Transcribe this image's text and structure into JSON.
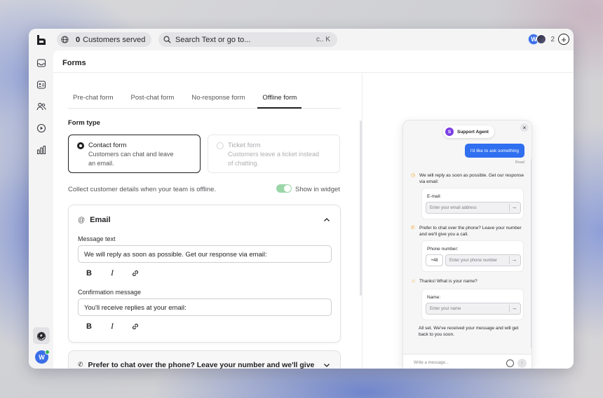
{
  "topbar": {
    "served_count": "0",
    "served_label": "Customers served",
    "search_placeholder": "Search Text or go to...",
    "search_shortcut": "c.. K",
    "avatar_initial": "W",
    "online_count": "2",
    "add_label": "+"
  },
  "sidebar": {
    "items": [
      {
        "icon": "inbox-icon"
      },
      {
        "icon": "contact-card-icon"
      },
      {
        "icon": "users-icon"
      },
      {
        "icon": "play-circle-icon"
      },
      {
        "icon": "bar-chart-icon"
      }
    ],
    "bottom": [
      {
        "icon": "gear-icon"
      },
      {
        "icon": "help-icon"
      }
    ],
    "avatar_initial": "W",
    "status_color": "#2fb35a"
  },
  "page": {
    "title": "Forms",
    "tabs": [
      {
        "label": "Pre-chat form"
      },
      {
        "label": "Post-chat form"
      },
      {
        "label": "No-response form"
      },
      {
        "label": "Offline form"
      }
    ],
    "active_tab": "Offline form",
    "form_type_label": "Form type",
    "choices": [
      {
        "title": "Contact form",
        "desc_1": "Customers can chat and leave",
        "desc_2": "an email.",
        "selected": true
      },
      {
        "title": "Ticket form",
        "desc_1": "Customers leave a ticket instead",
        "desc_2": "of chatting.",
        "selected": false
      }
    ],
    "collect_text": "Collect customer details when your team is offline.",
    "show_in_widget_label": "Show in widget",
    "toggle_on_color": "#9bd6a8"
  },
  "email_card": {
    "title": "Email",
    "message_label": "Message text",
    "message_value": "We will reply as soon as possible. Get our response via email:",
    "confirm_label": "Confirmation message",
    "confirm_value": "You'll receive replies at your email:",
    "bold": "B",
    "italic": "I"
  },
  "phone_card": {
    "title": "Prefer to chat over the phone? Leave your number and we'll give"
  },
  "widget": {
    "agent_initial": "S",
    "agent_name": "Support Agent",
    "close": "×",
    "user_message": "I'd like to ask something",
    "read_label": "Read",
    "bot_email": "We will reply as soon as possible. Get our response via email:",
    "email_label": "E-mail:",
    "email_placeholder": "Enter your email address",
    "bot_phone": "Prefer to chat over the phone? Leave your number and we'll give you a call.",
    "phone_label": "Phone number:",
    "country_code": "+48",
    "phone_placeholder": "Enter your phone number",
    "bot_name": "Thanks! What is your name?",
    "name_label": "Name:",
    "name_placeholder": "Enter your name",
    "all_set": "All set. We've received your message and will get back to you soon.",
    "composer_placeholder": "Write a message...",
    "arrow": "→",
    "send_arrow": "↑",
    "user_bubble_color": "#2f6ff0",
    "agent_color": "#7b3fe4"
  }
}
